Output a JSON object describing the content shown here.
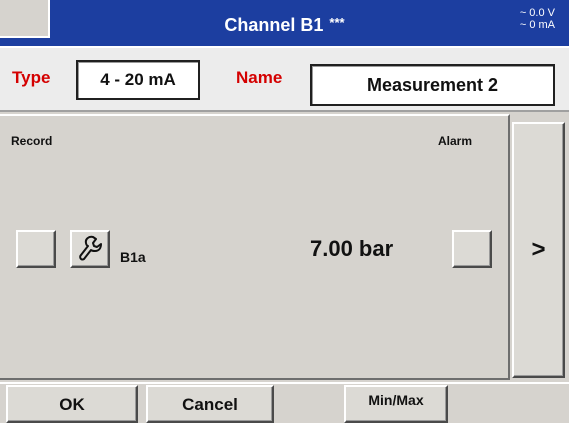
{
  "title": {
    "text": "Channel B1",
    "stars": "***",
    "readout_voltage": "~ 0.0 V",
    "readout_current": "~ 0 mA"
  },
  "config": {
    "type_label": "Type",
    "type_value": "4 - 20 mA",
    "name_label": "Name",
    "name_value": "Measurement 2"
  },
  "panel": {
    "record_label": "Record",
    "alarm_label": "Alarm",
    "channel_id": "B1a",
    "value": "7.00 bar",
    "next_label": ">"
  },
  "buttons": {
    "ok": "OK",
    "cancel": "Cancel",
    "minmax": "Min/Max"
  },
  "colors": {
    "title_bar": "#1c3ea0",
    "label_red": "#d40000",
    "panel_bg": "#d6d3ce"
  },
  "icons": {
    "wrench": "wrench-icon"
  }
}
